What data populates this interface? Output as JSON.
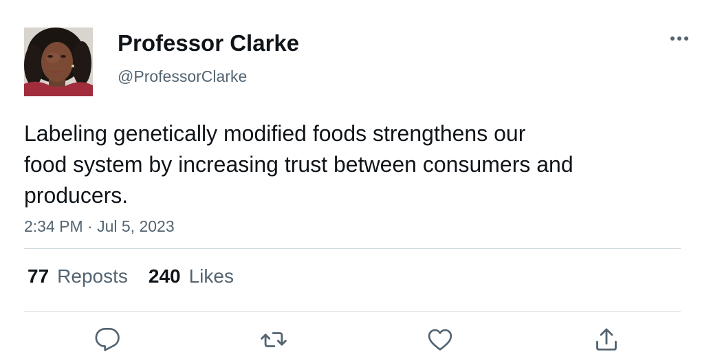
{
  "author": {
    "display_name": "Professor Clarke",
    "handle": "@ProfessorClarke"
  },
  "tweet": {
    "text_lines": [
      "Labeling genetically modified foods strengthens our",
      "food system by increasing trust between consumers and",
      "producers."
    ],
    "timestamp": "2:34 PM · Jul 5, 2023"
  },
  "stats": {
    "reposts_count": "77",
    "reposts_label": "Reposts",
    "likes_count": "240",
    "likes_label": "Likes"
  },
  "icons": {
    "more": "more-horizontal-icon",
    "reply": "reply-bubble-icon",
    "repost": "repost-arrows-icon",
    "like": "heart-icon",
    "share": "share-upload-icon"
  },
  "colors": {
    "text_primary": "#0f1419",
    "text_secondary": "#536471",
    "divider": "#cfd9de"
  }
}
